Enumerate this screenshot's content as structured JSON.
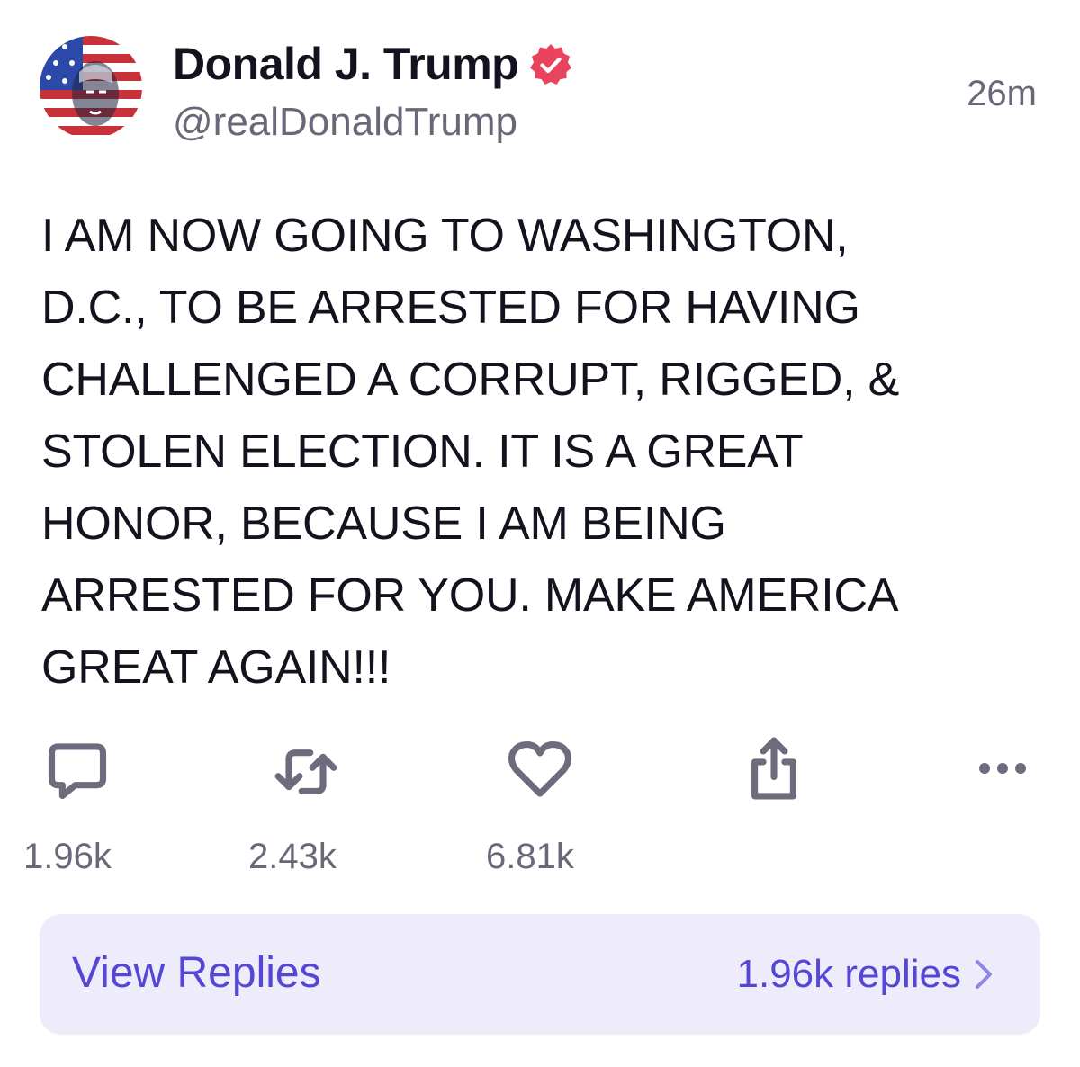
{
  "author": {
    "name": "Donald J. Trump",
    "handle": "@realDonaldTrump",
    "verified": true,
    "avatar_icon": "avatar-flag-portrait-icon"
  },
  "post": {
    "timestamp": "26m",
    "text": "I AM NOW GOING TO WASHINGTON,\nD.C., TO BE ARRESTED FOR HAVING\nCHALLENGED A CORRUPT, RIGGED, &\nSTOLEN ELECTION. IT IS A GREAT\nHONOR, BECAUSE I AM BEING\nARRESTED FOR YOU. MAKE AMERICA\nGREAT AGAIN!!!"
  },
  "actions": {
    "reply": {
      "icon": "reply-icon",
      "count": "1.96k"
    },
    "retruth": {
      "icon": "retruth-icon",
      "count": "2.43k"
    },
    "like": {
      "icon": "heart-icon",
      "count": "6.81k"
    },
    "share": {
      "icon": "share-icon"
    },
    "more": {
      "icon": "more-icon"
    }
  },
  "replies": {
    "label": "View Replies",
    "count_text": "1.96k replies",
    "chevron_icon": "chevron-right-icon"
  },
  "colors": {
    "text": "#14121f",
    "muted": "#6b6779",
    "icon": "#6f6b7d",
    "verified": "#e8445d",
    "accent": "#5547d6",
    "reply_bar_bg": "#eeecfb"
  }
}
